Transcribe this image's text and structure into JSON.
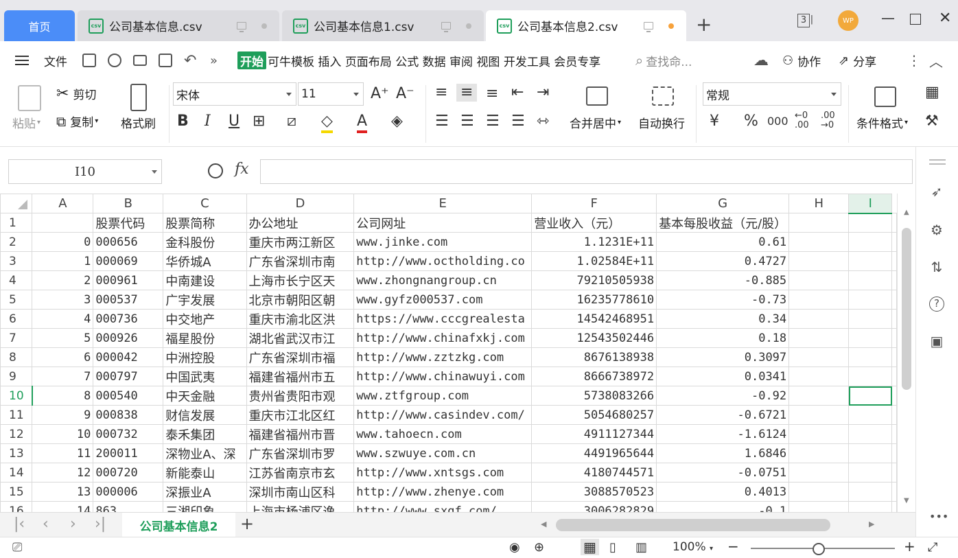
{
  "tabs": {
    "home": "首页",
    "files": [
      {
        "name": "公司基本信息.csv",
        "active": false
      },
      {
        "name": "公司基本信息1.csv",
        "active": false
      },
      {
        "name": "公司基本信息2.csv",
        "active": true
      }
    ],
    "csv_badge": "csv",
    "window_count": "3",
    "avatar": "WP"
  },
  "menu": {
    "file": "文件",
    "start": "开始",
    "items": [
      "可牛模板",
      "插入",
      "页面布局",
      "公式",
      "数据",
      "审阅",
      "视图",
      "开发工具",
      "会员专享"
    ],
    "search_placeholder": "查找命...",
    "collab": "协作",
    "share": "分享"
  },
  "ribbon": {
    "paste": "粘贴",
    "cut": "剪切",
    "copy": "复制",
    "format_painter": "格式刷",
    "font_name": "宋体",
    "font_size": "11",
    "merge_center": "合并居中",
    "wrap_text": "自动换行",
    "number_format": "常规",
    "conditional_format": "条件格式"
  },
  "formula_bar": {
    "cell_ref": "I10",
    "fx": "fx",
    "value": ""
  },
  "grid": {
    "columns": [
      "A",
      "B",
      "C",
      "D",
      "E",
      "F",
      "G",
      "H",
      "I"
    ],
    "selected_col": "I",
    "selected_row": 10,
    "rows": [
      {
        "n": "1",
        "cells": [
          "",
          "股票代码",
          "股票简称",
          "办公地址",
          "公司网址",
          "营业收入（元）",
          "基本每股收益（元/股）",
          "",
          ""
        ]
      },
      {
        "n": "2",
        "cells": [
          "0",
          "000656",
          "金科股份",
          "重庆市两江新区",
          "www.jinke.com",
          "1.1231E+11",
          "0.61",
          "",
          ""
        ]
      },
      {
        "n": "3",
        "cells": [
          "1",
          "000069",
          "华侨城A",
          "广东省深圳市南",
          "http://www.octholding.co",
          "1.02584E+11",
          "0.4727",
          "",
          ""
        ]
      },
      {
        "n": "4",
        "cells": [
          "2",
          "000961",
          "中南建设",
          "上海市长宁区天",
          "www.zhongnangroup.cn",
          "79210505938",
          "-0.885",
          "",
          ""
        ]
      },
      {
        "n": "5",
        "cells": [
          "3",
          "000537",
          "广宇发展",
          "北京市朝阳区朝",
          "www.gyfz000537.com",
          "16235778610",
          "-0.73",
          "",
          ""
        ]
      },
      {
        "n": "6",
        "cells": [
          "4",
          "000736",
          "中交地产",
          "重庆市渝北区洪",
          "https://www.cccgrealesta",
          "14542468951",
          "0.34",
          "",
          ""
        ]
      },
      {
        "n": "7",
        "cells": [
          "5",
          "000926",
          "福星股份",
          "湖北省武汉市江",
          "http://www.chinafxkj.com",
          "12543502446",
          "0.18",
          "",
          ""
        ]
      },
      {
        "n": "8",
        "cells": [
          "6",
          "000042",
          "中洲控股",
          "广东省深圳市福",
          "http://www.zztzkg.com",
          "8676138938",
          "0.3097",
          "",
          ""
        ]
      },
      {
        "n": "9",
        "cells": [
          "7",
          "000797",
          "中国武夷",
          "福建省福州市五",
          "http://www.chinawuyi.com",
          "8666738972",
          "0.0341",
          "",
          ""
        ]
      },
      {
        "n": "10",
        "cells": [
          "8",
          "000540",
          "中天金融",
          "贵州省贵阳市观",
          "www.ztfgroup.com",
          "5738083266",
          "-0.92",
          "",
          ""
        ]
      },
      {
        "n": "11",
        "cells": [
          "9",
          "000838",
          "财信发展",
          "重庆市江北区红",
          "http://www.casindev.com/",
          "5054680257",
          "-0.6721",
          "",
          ""
        ]
      },
      {
        "n": "12",
        "cells": [
          "10",
          "000732",
          "泰禾集团",
          "福建省福州市晋",
          "www.tahoecn.com",
          "4911127344",
          "-1.6124",
          "",
          ""
        ]
      },
      {
        "n": "13",
        "cells": [
          "11",
          "200011",
          "深物业A、深",
          "广东省深圳市罗",
          "www.szwuye.com.cn",
          "4491965644",
          "1.6846",
          "",
          ""
        ]
      },
      {
        "n": "14",
        "cells": [
          "12",
          "000720",
          "新能泰山",
          "江苏省南京市玄",
          "http://www.xntsgs.com",
          "4180744571",
          "-0.0751",
          "",
          ""
        ]
      },
      {
        "n": "15",
        "cells": [
          "13",
          "000006",
          "深振业A",
          "深圳市南山区科",
          "http://www.zhenye.com",
          "3088570523",
          "0.4013",
          "",
          ""
        ]
      },
      {
        "n": "16",
        "cells": [
          "14",
          "863",
          "三湘印象",
          "上海市杨浦区逸",
          "http://www.sxgf.com/",
          "3006282829",
          "-0.1",
          "",
          ""
        ]
      }
    ]
  },
  "sheets": {
    "active": "公司基本信息2"
  },
  "status": {
    "zoom": "100%"
  }
}
